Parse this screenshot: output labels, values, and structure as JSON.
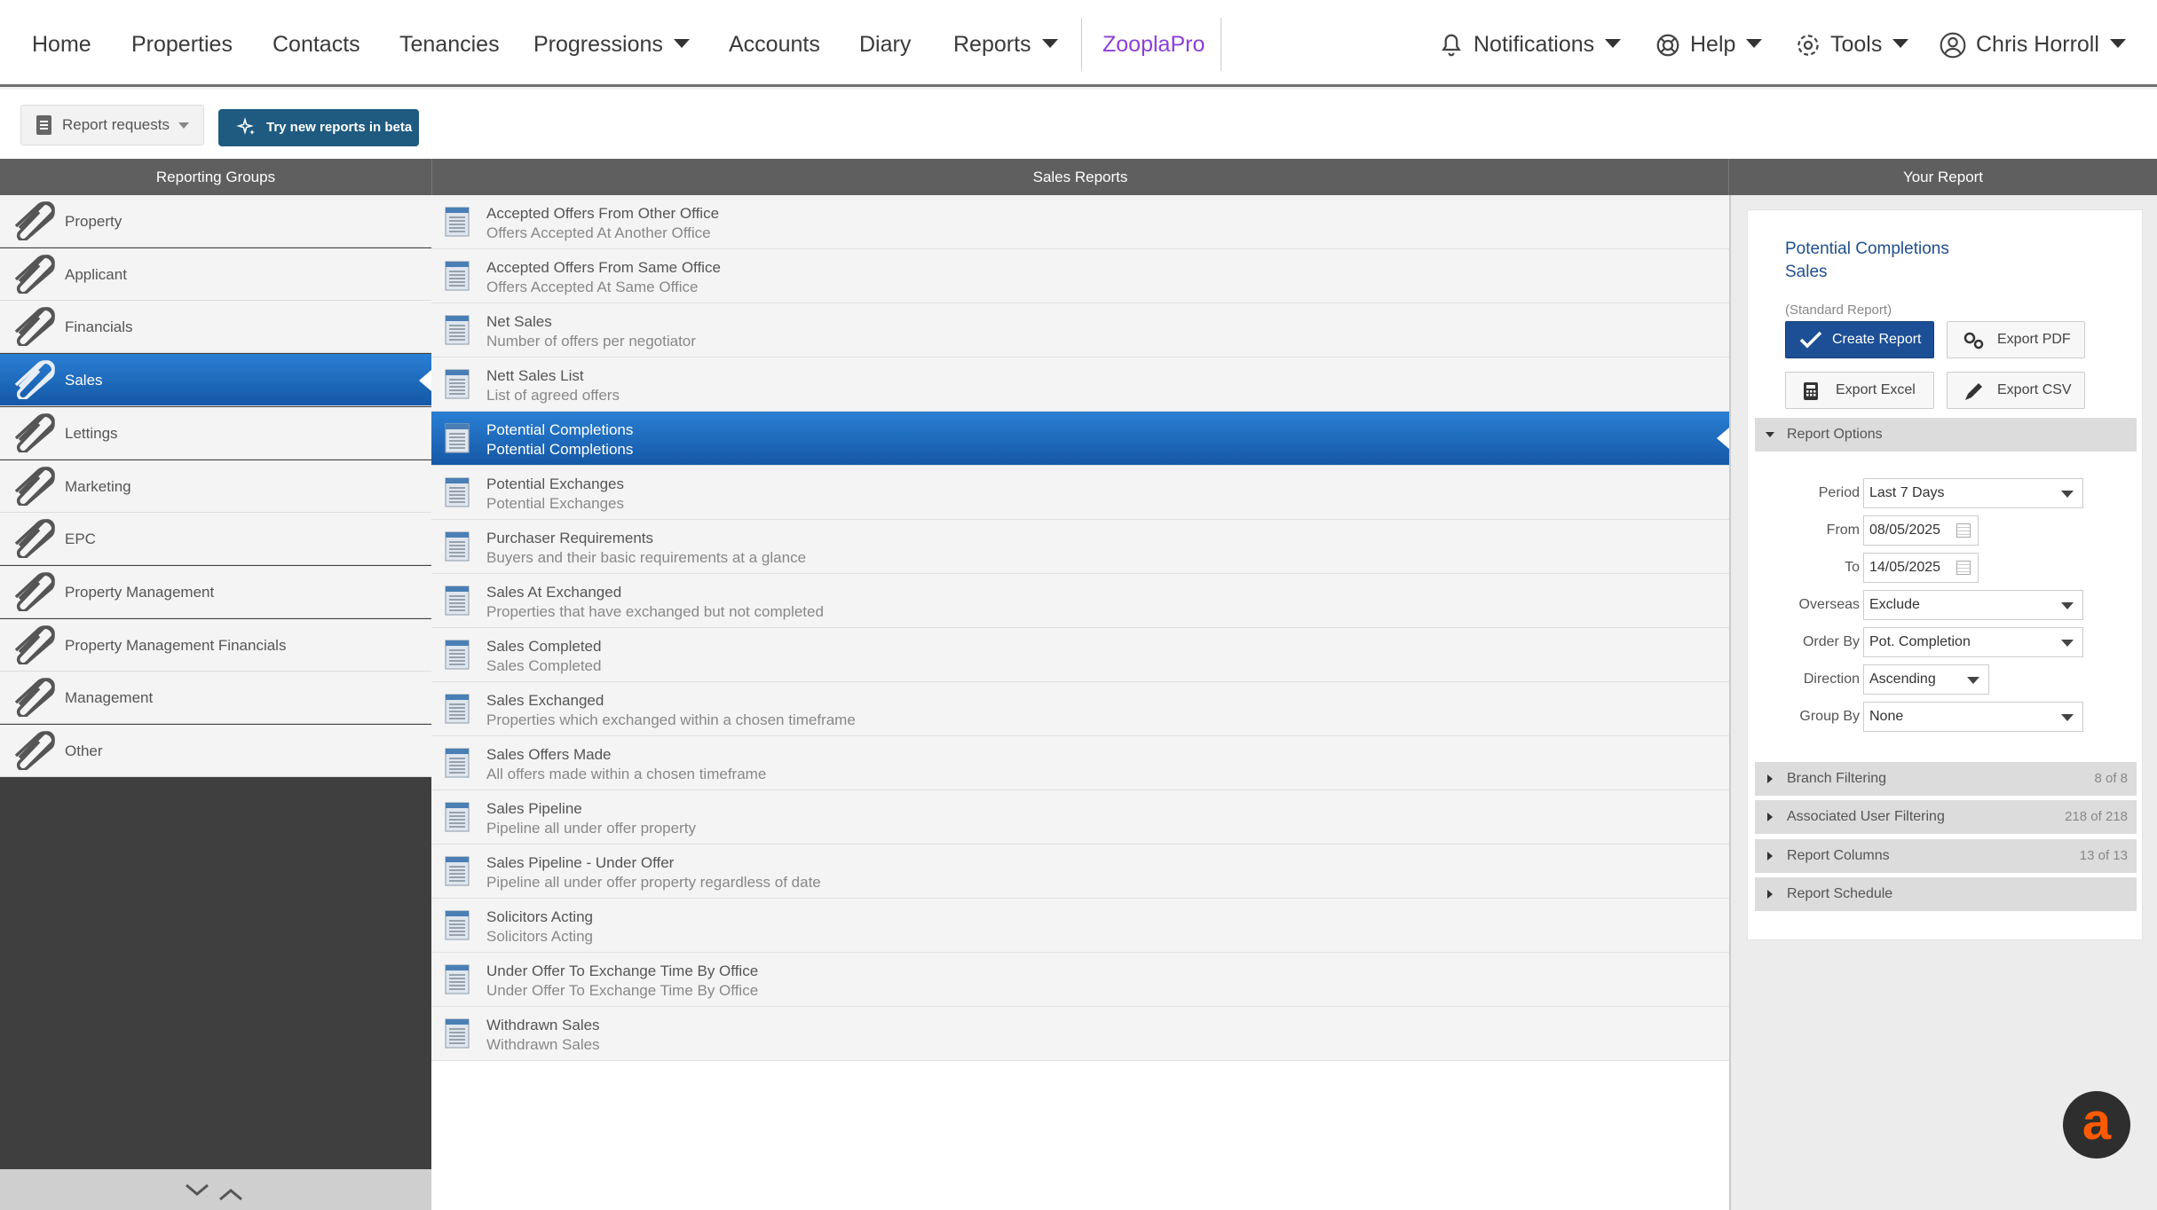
{
  "nav": {
    "items": [
      "Home",
      "Properties",
      "Contacts",
      "Tenancies",
      "Progressions",
      "Accounts",
      "Diary",
      "Reports"
    ],
    "zoopla": "ZooplaPro",
    "notifications": "Notifications",
    "help": "Help",
    "tools": "Tools",
    "user": "Chris Horroll"
  },
  "toolbar": {
    "report_requests": "Report requests",
    "beta": "Try new reports in beta"
  },
  "columns": {
    "groups": "Reporting Groups",
    "reports": "Sales Reports",
    "your_report": "Your Report"
  },
  "groups": [
    "Property",
    "Applicant",
    "Financials",
    "Sales",
    "Lettings",
    "Marketing",
    "EPC",
    "Property Management",
    "Property Management Financials",
    "Management",
    "Other"
  ],
  "active_group": "Sales",
  "reports": [
    {
      "title": "Accepted Offers From Other Office",
      "desc": "Offers Accepted At Another Office"
    },
    {
      "title": "Accepted Offers From Same Office",
      "desc": "Offers Accepted At Same Office"
    },
    {
      "title": "Net Sales",
      "desc": "Number of offers per negotiator"
    },
    {
      "title": "Nett Sales List",
      "desc": "List of agreed offers"
    },
    {
      "title": "Potential Completions",
      "desc": "Potential Completions"
    },
    {
      "title": "Potential Exchanges",
      "desc": "Potential Exchanges"
    },
    {
      "title": "Purchaser Requirements",
      "desc": "Buyers and their basic requirements at a glance"
    },
    {
      "title": "Sales At Exchanged",
      "desc": "Properties that have exchanged but not completed"
    },
    {
      "title": "Sales Completed",
      "desc": "Sales Completed"
    },
    {
      "title": "Sales Exchanged",
      "desc": "Properties which exchanged within a chosen timeframe"
    },
    {
      "title": "Sales Offers Made",
      "desc": "All offers made within a chosen timeframe"
    },
    {
      "title": "Sales Pipeline",
      "desc": "Pipeline all under offer property"
    },
    {
      "title": "Sales Pipeline - Under Offer",
      "desc": "Pipeline all under offer property regardless of date"
    },
    {
      "title": "Solicitors Acting",
      "desc": "Solicitors Acting"
    },
    {
      "title": "Under Offer To Exchange Time By Office",
      "desc": "Under Offer To Exchange Time By Office"
    },
    {
      "title": "Withdrawn Sales",
      "desc": "Withdrawn Sales"
    }
  ],
  "active_report": "Potential Completions",
  "your_report": {
    "title": "Potential Completions",
    "group": "Sales",
    "type": "(Standard Report)",
    "create": "Create Report",
    "export_pdf": "Export PDF",
    "export_excel": "Export Excel",
    "export_csv": "Export CSV",
    "options_title": "Report Options",
    "options": {
      "period_label": "Period",
      "period": "Last 7 Days",
      "from_label": "From",
      "from": "08/05/2025",
      "to_label": "To",
      "to": "14/05/2025",
      "overseas_label": "Overseas",
      "overseas": "Exclude",
      "order_label": "Order By",
      "order": "Pot. Completion",
      "direction_label": "Direction",
      "direction": "Ascending",
      "group_label": "Group By",
      "group": "None"
    },
    "sections": [
      {
        "label": "Branch Filtering",
        "count": "8 of 8"
      },
      {
        "label": "Associated User Filtering",
        "count": "218 of 218"
      },
      {
        "label": "Report Columns",
        "count": "13 of 13"
      },
      {
        "label": "Report Schedule",
        "count": ""
      }
    ]
  },
  "colors": {
    "active_gradient_top": "#2a7fd4",
    "active_gradient_bottom": "#1558a6",
    "primary_button": "#1c4f96",
    "beta_button": "#1f5a80",
    "zoopla": "#8b3fd9",
    "amplify": "#ff5a00"
  }
}
